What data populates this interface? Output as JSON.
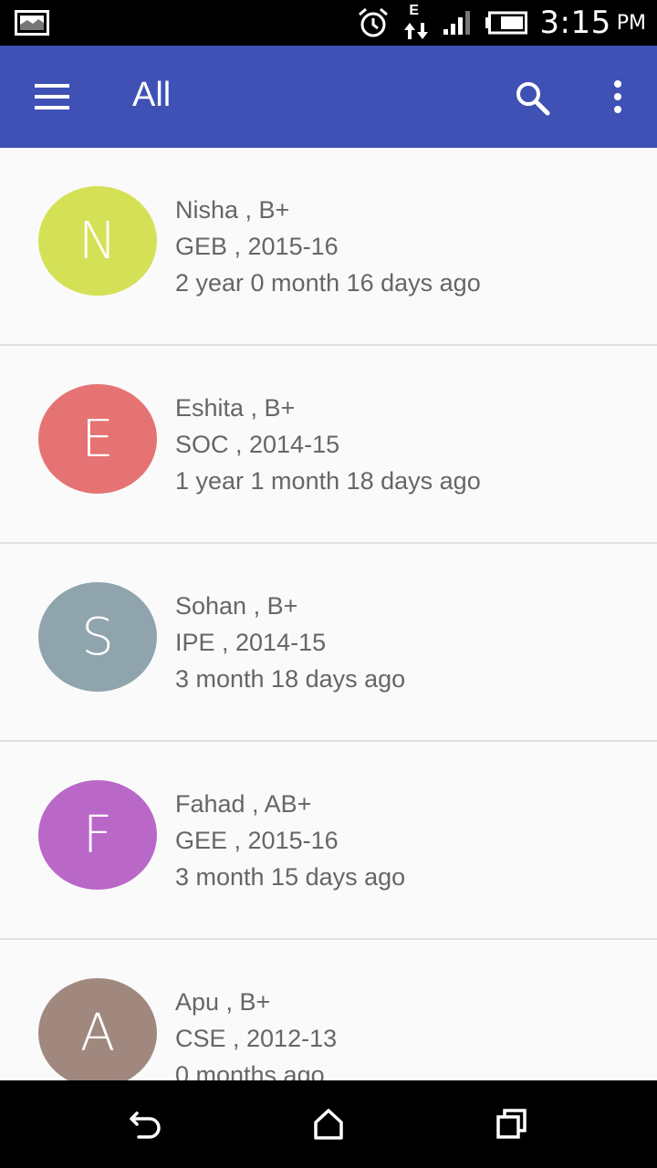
{
  "status_bar": {
    "time": "3:15",
    "ampm": "PM",
    "network_label": "E",
    "icons": [
      "gallery-icon",
      "alarm-icon",
      "data-transfer-icon",
      "signal-icon",
      "battery-icon"
    ]
  },
  "app_bar": {
    "title": "All",
    "icons": [
      "menu-icon",
      "search-icon",
      "more-vert-icon"
    ],
    "color": "#3f51b5"
  },
  "contacts": [
    {
      "initial": "N",
      "color": "#d4e157",
      "name": "Nisha , B+",
      "dept": "GEB , 2015-16",
      "ago": "2 year 0 month 16 days ago"
    },
    {
      "initial": "E",
      "color": "#e57373",
      "name": "Eshita , B+",
      "dept": "SOC , 2014-15",
      "ago": "1 year 1 month 18 days ago"
    },
    {
      "initial": "S",
      "color": "#90a4ae",
      "name": "Sohan , B+",
      "dept": "IPE , 2014-15",
      "ago": "3 month 18 days ago"
    },
    {
      "initial": "F",
      "color": "#ba68c8",
      "name": "Fahad , AB+",
      "dept": "GEE , 2015-16",
      "ago": "3 month 15 days ago"
    },
    {
      "initial": "A",
      "color": "#a1887f",
      "name": "Apu , B+",
      "dept": "CSE , 2012-13",
      "ago": "0 months ago"
    }
  ],
  "nav_bar": {
    "icons": [
      "back-icon",
      "home-icon",
      "recents-icon"
    ]
  }
}
